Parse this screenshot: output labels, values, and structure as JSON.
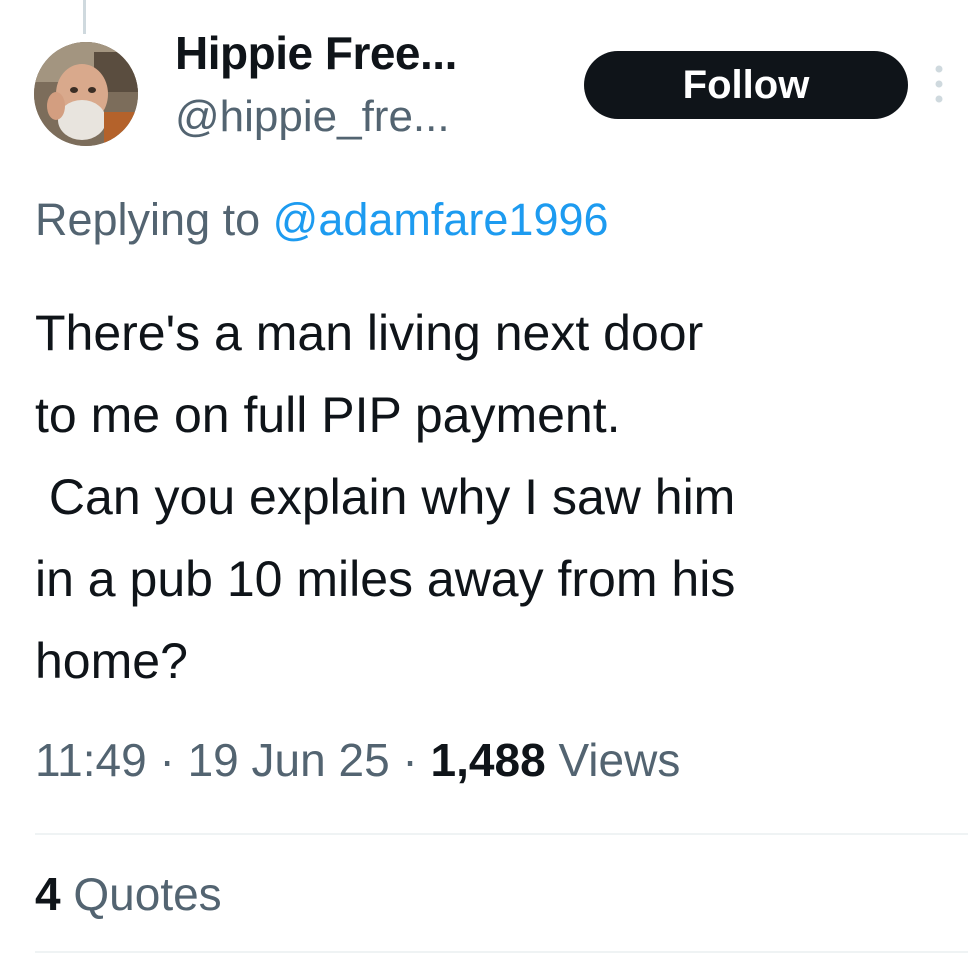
{
  "author": {
    "display_name": "Hippie Free...",
    "handle": "@hippie_fre..."
  },
  "follow_label": "Follow",
  "reply_context": {
    "prefix": "Replying to ",
    "mention": "@adamfare1996"
  },
  "tweet": {
    "text": "There's a man living next door\nto me on full PIP payment.\n Can you explain why I saw him\nin a pub 10 miles away from his\nhome?"
  },
  "meta": {
    "time": "11:49",
    "separator": " · ",
    "date": "19 Jun 25",
    "views_count": "1,488",
    "views_label": " Views"
  },
  "engagement": {
    "quotes_count": "4",
    "quotes_label": " Quotes"
  },
  "icons": {
    "more": "more-vertical-icon"
  },
  "colors": {
    "primary_text": "#0f1419",
    "secondary_text": "#536471",
    "link": "#1d9bf0",
    "follow_button_bg": "#0f1419",
    "divider": "#eff3f4"
  }
}
